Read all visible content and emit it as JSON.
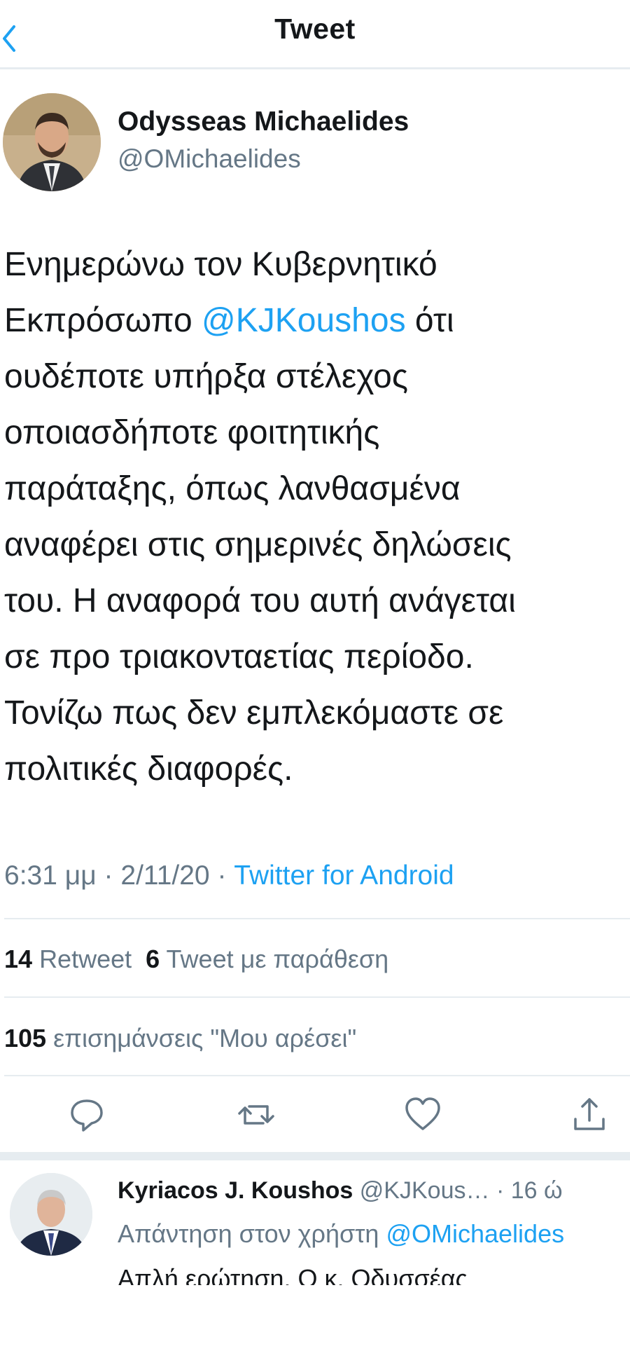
{
  "nav": {
    "title": "Tweet"
  },
  "tweet": {
    "author_name": "Odysseas Michaelides",
    "author_handle": "@OMichaelides",
    "body_lines": [
      {
        "text": "Ενημερώνω τον Κυβερνητικό"
      },
      {
        "pre": "Εκπρόσωπο ",
        "mention": "@KJKoushos",
        "post": " ότι"
      },
      {
        "text": "ουδέποτε υπήρξα στέλεχος"
      },
      {
        "text": "οποιασδήποτε φοιτητικής"
      },
      {
        "text": "παράταξης, όπως λανθασμένα"
      },
      {
        "text": "αναφέρει στις σημερινές δηλώσεις"
      },
      {
        "text": "του. Η αναφορά του αυτή ανάγεται"
      },
      {
        "text": "σε προ τριακονταετίας περίοδο."
      },
      {
        "text": "Τονίζω πως δεν εμπλεκόμαστε σε"
      },
      {
        "text": "πολιτικές διαφορές."
      }
    ],
    "time": "6:31 μμ",
    "date": "2/11/20",
    "separator": "·",
    "source": "Twitter for Android",
    "retweets_count": "14",
    "retweets_label": "Retweet",
    "quotes_count": "6",
    "quotes_label": "Tweet με παράθεση",
    "likes_count": "105",
    "likes_label": "επισημάνσεις \"Μου αρέσει\""
  },
  "actions": {
    "reply_icon": "reply-icon",
    "retweet_icon": "retweet-icon",
    "like_icon": "heart-icon",
    "share_icon": "share-icon"
  },
  "reply": {
    "author_name": "Kyriacos J. Koushos",
    "author_handle": "@KJKous…",
    "time": "· 16 ώ",
    "replying_label": "Απάντηση στον χρήστη ",
    "replying_mention": "@OMichaelides",
    "text": "Απλή ερώτηση. Ο κ. Οδυσσέας"
  },
  "colors": {
    "accent": "#1da1f2",
    "secondary_text": "#657786",
    "primary_text": "#14171a",
    "divider": "#e6ecf0"
  }
}
